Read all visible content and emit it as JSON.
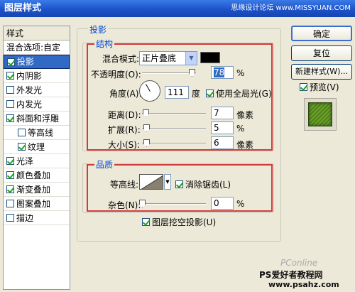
{
  "window": {
    "title": "图层样式",
    "watermark": "思缘设计论坛 www.MISSYUAN.COM"
  },
  "left_panel": {
    "header": "样式",
    "items": [
      {
        "label": "混合选项:自定",
        "checkbox": false,
        "has_checkbox": false
      },
      {
        "label": "投影",
        "checkbox": true,
        "has_checkbox": true
      },
      {
        "label": "内阴影",
        "checkbox": true,
        "has_checkbox": true
      },
      {
        "label": "外发光",
        "checkbox": false,
        "has_checkbox": true
      },
      {
        "label": "内发光",
        "checkbox": false,
        "has_checkbox": true
      },
      {
        "label": "斜面和浮雕",
        "checkbox": true,
        "has_checkbox": true
      },
      {
        "label": "等高线",
        "checkbox": false,
        "has_checkbox": true
      },
      {
        "label": "纹理",
        "checkbox": true,
        "has_checkbox": true
      },
      {
        "label": "光泽",
        "checkbox": true,
        "has_checkbox": true
      },
      {
        "label": "颜色叠加",
        "checkbox": true,
        "has_checkbox": true
      },
      {
        "label": "渐变叠加",
        "checkbox": true,
        "has_checkbox": true
      },
      {
        "label": "图案叠加",
        "checkbox": false,
        "has_checkbox": true
      },
      {
        "label": "描边",
        "checkbox": false,
        "has_checkbox": true
      }
    ]
  },
  "main": {
    "group_title": "投影",
    "structure": {
      "title": "结构",
      "blend_label": "混合模式:",
      "blend_value": "正片叠底",
      "opacity_label": "不透明度(O):",
      "opacity_value": "78",
      "opacity_unit": "%",
      "angle_label": "角度(A):",
      "angle_value": "111",
      "angle_unit": "度",
      "global_light_label": "使用全局光(G)",
      "distance_label": "距离(D):",
      "distance_value": "7",
      "distance_unit": "像素",
      "spread_label": "扩展(R):",
      "spread_value": "5",
      "spread_unit": "%",
      "size_label": "大小(S):",
      "size_value": "6",
      "size_unit": "像素"
    },
    "quality": {
      "title": "品质",
      "contour_label": "等高线:",
      "antialias_label": "消除锯齿(L)",
      "noise_label": "杂色(N):",
      "noise_value": "0",
      "noise_unit": "%"
    },
    "knockout_label": "图层挖空投影(U)"
  },
  "buttons": {
    "ok": "确定",
    "reset": "复位",
    "new_style": "新建样式(W)...",
    "preview": "预览(V)"
  },
  "footer": {
    "brand": "PS爱好者教程网",
    "url": "www.psahz.com",
    "logo": "PConline"
  },
  "colors": {
    "accent": "#316ac5",
    "group_title": "#0046d5",
    "highlight_box": "#d23b3b"
  }
}
